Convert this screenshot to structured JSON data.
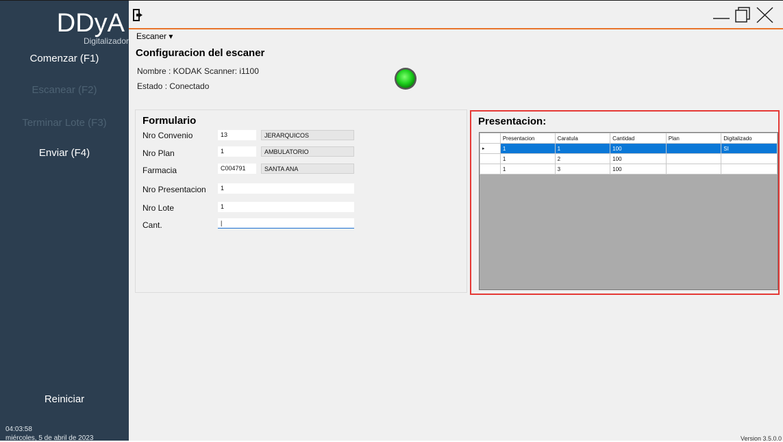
{
  "sidebar": {
    "logo": "DDyA",
    "logo_sub": "Digitalizador",
    "buttons": {
      "comenzar": "Comenzar (F1)",
      "escanear": "Escanear (F2)",
      "terminar": "Terminar Lote (F3)",
      "enviar": "Enviar (F4)",
      "reiniciar": "Reiniciar"
    },
    "clock": {
      "time": "04:03:58",
      "date": "miércoles, 5 de abril de 2023"
    }
  },
  "titlebar": {
    "icons": [
      "exit-icon",
      "minimize-icon",
      "maximize-icon",
      "close-icon"
    ]
  },
  "menu": {
    "escaner": "Escaner ▾"
  },
  "config": {
    "title": "Configuracion del escaner",
    "nombre": "Nombre : KODAK Scanner: i1100",
    "estado": "Estado : Conectado",
    "status_color": "#22c02a"
  },
  "form": {
    "title": "Formulario",
    "fields": {
      "convenio": {
        "label": "Nro Convenio",
        "code": "13",
        "desc": "JERARQUICOS"
      },
      "plan": {
        "label": "Nro Plan",
        "code": "1",
        "desc": "AMBULATORIO"
      },
      "farmacia": {
        "label": "Farmacia",
        "code": "C004791",
        "desc": "SANTA ANA"
      },
      "presentacion": {
        "label": "Nro Presentacion",
        "value": "1"
      },
      "lote": {
        "label": "Nro Lote",
        "value": "1"
      },
      "cant": {
        "label": "Cant.",
        "value": "|"
      }
    }
  },
  "presentacion": {
    "title": "Presentacion:",
    "columns": [
      "Presentacion",
      "Caratula",
      "Cantidad",
      "Plan",
      "Digitalizado"
    ],
    "rows": [
      {
        "marker": "▸",
        "cells": [
          "1",
          "1",
          "100",
          "",
          "SI"
        ]
      },
      {
        "marker": "",
        "cells": [
          "1",
          "2",
          "100",
          "",
          ""
        ]
      },
      {
        "marker": "",
        "cells": [
          "1",
          "3",
          "100",
          "",
          ""
        ]
      }
    ]
  },
  "colors": {
    "sidebar_bg": "#2c3e50",
    "accent_orange": "#e8742a",
    "highlight_red": "#e53935",
    "selection_blue": "#0a78d7"
  },
  "version": "Version 3.5.0.0"
}
